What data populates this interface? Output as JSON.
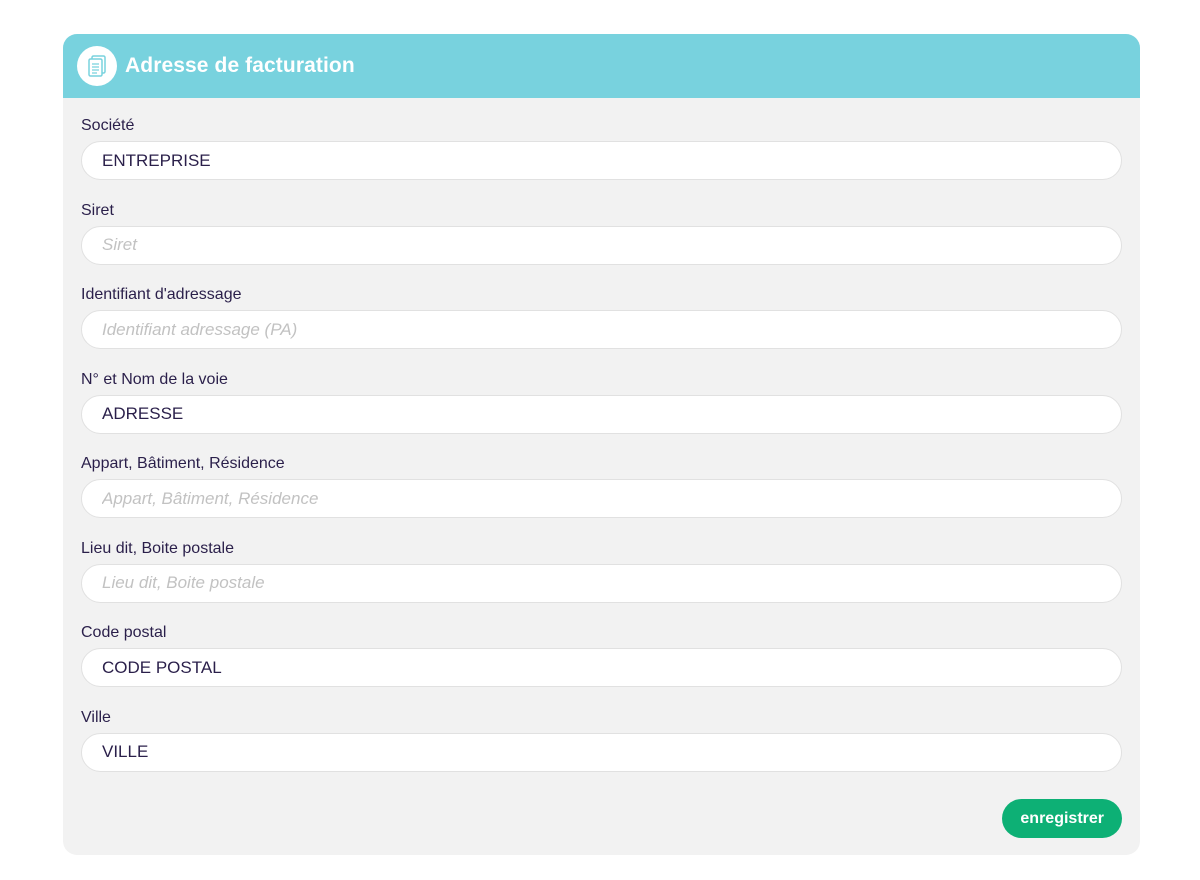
{
  "card": {
    "title": "Adresse de facturation",
    "icon": "document-icon",
    "header_color": "#78d2de"
  },
  "fields": [
    {
      "label": "Société",
      "value": "ENTREPRISE",
      "placeholder": ""
    },
    {
      "label": "Siret",
      "value": "",
      "placeholder": "Siret"
    },
    {
      "label": "Identifiant d'adressage",
      "value": "",
      "placeholder": "Identifiant adressage (PA)"
    },
    {
      "label": "N° et Nom de la voie",
      "value": "ADRESSE",
      "placeholder": ""
    },
    {
      "label": "Appart, Bâtiment, Résidence",
      "value": "",
      "placeholder": "Appart, Bâtiment, Résidence"
    },
    {
      "label": "Lieu dit, Boite postale",
      "value": "",
      "placeholder": "Lieu dit, Boite postale"
    },
    {
      "label": "Code postal",
      "value": "CODE POSTAL",
      "placeholder": ""
    },
    {
      "label": "Ville",
      "value": "VILLE",
      "placeholder": ""
    }
  ],
  "actions": {
    "save_label": "enregistrer",
    "save_color": "#0db075"
  }
}
